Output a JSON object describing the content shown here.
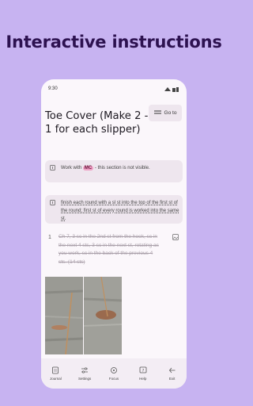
{
  "headline": "Interactive instructions",
  "status_bar": {
    "time": "9:30"
  },
  "goto_label": "Go to",
  "title": "Toe Cover (Make 2 - 1 for each slipper)",
  "notice": {
    "pre": "Work with",
    "badge": "MC",
    "post": "- this section is not visible."
  },
  "tip": "finish each round with a sl st into the top of the first st of the round; first st of every round is worked into the same st.",
  "step": {
    "number": "1",
    "text": "Ch 7, 3 sc in the 2nd st from the hook, sc in the next 4 sts, 3 sc in the next st, rotating as you work, sc in the back of the previous 4 sts. (14 sts)"
  },
  "nav": [
    {
      "label": "Journal",
      "icon": "journal-icon"
    },
    {
      "label": "Settings",
      "icon": "settings-icon"
    },
    {
      "label": "Focus",
      "icon": "focus-icon"
    },
    {
      "label": "Help",
      "icon": "help-icon"
    },
    {
      "label": "Exit",
      "icon": "exit-icon"
    }
  ],
  "colors": {
    "background": "#c7b3f1",
    "headline": "#2d1250",
    "badge": "#ee9fc4",
    "card": "#eee6ee"
  }
}
